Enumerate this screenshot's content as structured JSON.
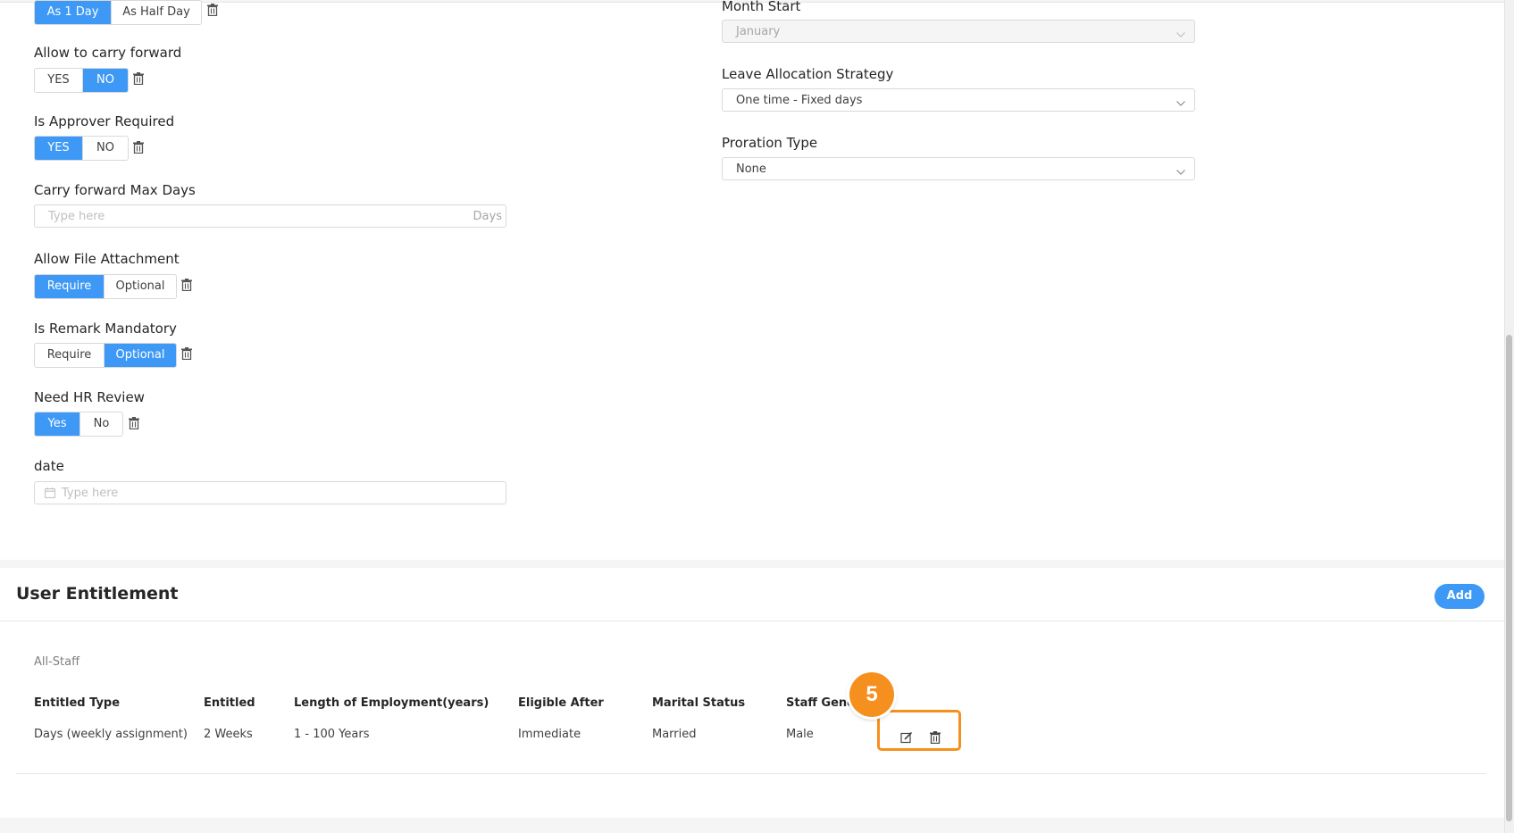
{
  "left_form": {
    "leave_day_type": {
      "options": [
        "As 1 Day",
        "As Half Day"
      ],
      "selected": 0
    },
    "carry_forward": {
      "label": "Allow to carry forward",
      "options": [
        "YES",
        "NO"
      ],
      "selected": 1
    },
    "approver_required": {
      "label": "Is Approver Required",
      "options": [
        "YES",
        "NO"
      ],
      "selected": 0
    },
    "carry_forward_max": {
      "label": "Carry forward Max Days",
      "placeholder": "Type here",
      "suffix": "Days"
    },
    "file_attachment": {
      "label": "Allow File Attachment",
      "options": [
        "Require",
        "Optional"
      ],
      "selected": 0
    },
    "remark_mandatory": {
      "label": "Is Remark Mandatory",
      "options": [
        "Require",
        "Optional"
      ],
      "selected": 1
    },
    "hr_review": {
      "label": "Need HR Review",
      "options": [
        "Yes",
        "No"
      ],
      "selected": 0
    },
    "date": {
      "label": "date",
      "placeholder": "Type here"
    }
  },
  "right_form": {
    "month_start": {
      "label": "Month Start",
      "value": "January"
    },
    "allocation_strategy": {
      "label": "Leave Allocation Strategy",
      "value": "One time - Fixed days"
    },
    "proration_type": {
      "label": "Proration Type",
      "value": "None"
    }
  },
  "entitlement": {
    "title": "User Entitlement",
    "add_label": "Add",
    "group": "All-Staff",
    "columns": [
      "Entitled Type",
      "Entitled",
      "Length of Employment(years)",
      "Eligible After",
      "Marital Status",
      "Staff Gend"
    ],
    "rows": [
      [
        "Days (weekly assignment)",
        "2 Weeks",
        "1 - 100 Years",
        "Immediate",
        "Married",
        "Male"
      ]
    ]
  },
  "annotation": {
    "step_number": "5"
  },
  "colors": {
    "primary": "#3d99f5",
    "highlight": "#f5901e"
  },
  "icons": {
    "delete": "trash-icon",
    "edit": "edit-icon",
    "calendar": "calendar-icon",
    "dropdown": "chevron-down-icon"
  }
}
